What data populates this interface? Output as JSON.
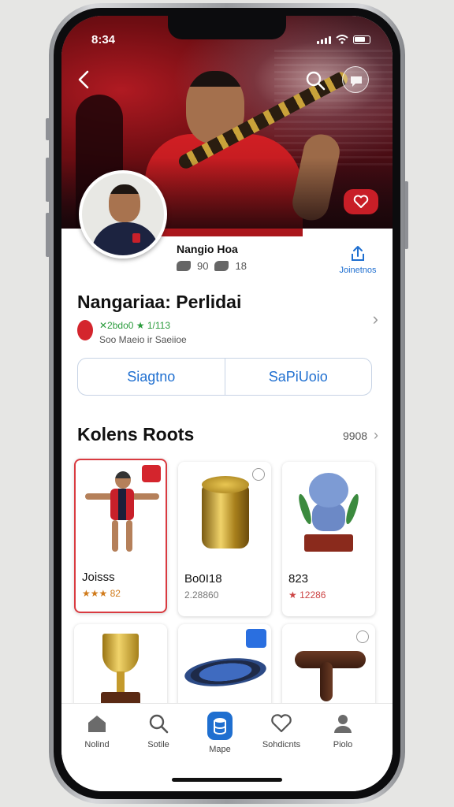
{
  "status": {
    "time": "8:34"
  },
  "profile": {
    "name": "Nangio Hoa",
    "stat_a": "90",
    "stat_b": "18",
    "share_label": "Joinetnos"
  },
  "title": "Nangariaa: Perlidai",
  "meta": {
    "line1": "✕2bdo0 ★ 1/113",
    "line2": "Soo Maeio ir Saeiioe"
  },
  "segments": [
    "Siagtno",
    "SaPiUoio"
  ],
  "section": {
    "title": "Kolens Roots",
    "link": "9908"
  },
  "items": [
    {
      "name": "Joisss",
      "rating": "★★★ 82",
      "selected": true,
      "badge": "red"
    },
    {
      "name": "Bo0I18",
      "rating": "2.28860",
      "selected": false,
      "badge": "grey"
    },
    {
      "name": "823",
      "rating": "★ 12286",
      "selected": false,
      "badge": ""
    },
    {
      "name": "",
      "rating": "",
      "selected": false,
      "badge": ""
    },
    {
      "name": "",
      "rating": "",
      "selected": false,
      "badge": "blue"
    },
    {
      "name": "",
      "rating": "",
      "selected": false,
      "badge": "grey"
    }
  ],
  "tabs": [
    {
      "label": "Nolind",
      "icon": "home-icon"
    },
    {
      "label": "Sotile",
      "icon": "search-icon"
    },
    {
      "label": "Mape",
      "icon": "database-icon"
    },
    {
      "label": "Sohdicnts",
      "icon": "heart-icon"
    },
    {
      "label": "Piolo",
      "icon": "user-icon"
    }
  ],
  "colors": {
    "accent": "#1f6fd0",
    "brand_red": "#c81e27"
  }
}
